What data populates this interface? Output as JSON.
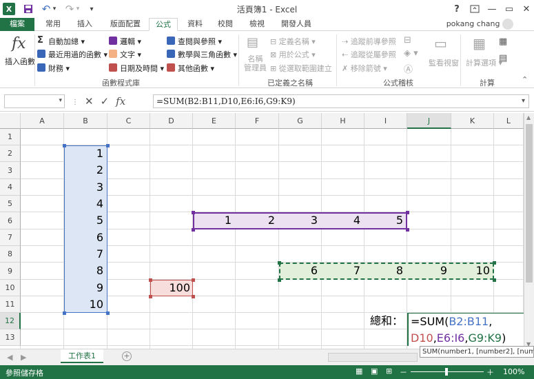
{
  "window": {
    "title": "活頁簿1 - Excel",
    "help": "?",
    "min": "—",
    "restore": "▭",
    "close": "✕"
  },
  "qat": {
    "app_icon": "X",
    "save": "💾",
    "undo": "↶",
    "redo": "↷",
    "more": "▾"
  },
  "tabs": [
    {
      "label": "檔案"
    },
    {
      "label": "常用"
    },
    {
      "label": "插入"
    },
    {
      "label": "版面配置"
    },
    {
      "label": "公式"
    },
    {
      "label": "資料"
    },
    {
      "label": "校閱"
    },
    {
      "label": "檢視"
    },
    {
      "label": "開發人員"
    }
  ],
  "user": "pokang chang",
  "ribbon": {
    "insert_fn_icon": "fx",
    "insert_fn": "插入函數",
    "autosum": "自動加總",
    "recent": "最近用過的函數",
    "financial": "財務",
    "logical": "邏輯",
    "text": "文字",
    "datetime": "日期及時間",
    "lookup": "查閱與參照",
    "math": "數學與三角函數",
    "other": "其他函數",
    "group_lib": "函數程式庫",
    "name_mgr": "名稱\n管理員",
    "define_name": "定義名稱",
    "use_in_formula": "用於公式",
    "create_sel": "從選取範圍建立",
    "group_names": "已定義之名稱",
    "trace_prec": "追蹤前導參照",
    "trace_dep": "追蹤從屬參照",
    "remove_arrows": "移除箭號",
    "watch": "監看視窗",
    "group_audit": "公式稽核",
    "calc_options": "計算選項",
    "group_calc": "計算"
  },
  "formula_bar": {
    "name_box": "",
    "content": "=SUM(B2:B11,D10,E6:I6,G9:K9)"
  },
  "columns": [
    "A",
    "B",
    "C",
    "D",
    "E",
    "F",
    "G",
    "H",
    "I",
    "J",
    "K",
    "L"
  ],
  "rows": [
    "1",
    "2",
    "3",
    "4",
    "5",
    "6",
    "7",
    "8",
    "9",
    "10",
    "11",
    "12",
    "13"
  ],
  "cells": {
    "b": [
      "1",
      "2",
      "3",
      "4",
      "5",
      "6",
      "7",
      "8",
      "9",
      "10"
    ],
    "row6": [
      "1",
      "2",
      "3",
      "4",
      "5"
    ],
    "d10": "100",
    "row9": [
      "6",
      "7",
      "8",
      "9",
      "10"
    ],
    "i12_label": "總和：",
    "edit_sum": "=SUM(",
    "edit_r1": "B2:B11",
    "edit_c1": ",",
    "edit_r2": "D10",
    "edit_c2": ",",
    "edit_r3": "E6:I6",
    "edit_c3": ",",
    "edit_r4": "G9:K9",
    "edit_end": ")"
  },
  "tooltip": "SUM(number1, [number2], [numb",
  "sheet": {
    "tab": "工作表1",
    "add": "+"
  },
  "status": {
    "text": "參照儲存格",
    "zoom": "100%",
    "zoom_minus": "－",
    "zoom_plus": "＋"
  },
  "colors": {
    "excel_green": "#217346",
    "blue": "#4472c4",
    "purple": "#7030a0",
    "red": "#c0504d",
    "green_dash": "#217346"
  }
}
